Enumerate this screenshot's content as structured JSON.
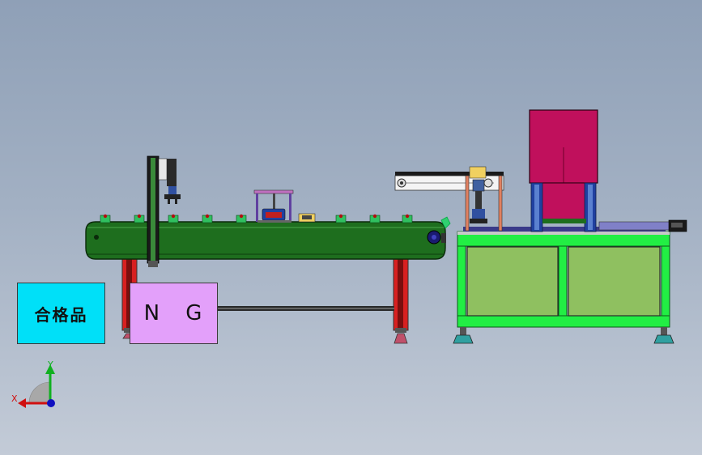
{
  "bins": {
    "ok_label": "合格品",
    "ng_label": "N G"
  },
  "axes": {
    "x_label": "X",
    "y_label": "Y"
  },
  "colors": {
    "conveyor": "#1e6e1e",
    "frame": "#22ee44",
    "panel": "#8fc060",
    "cabinet": "#c0105c",
    "ok_bin": "#00e0f8",
    "ng_bin": "#e3a0fa",
    "leg_red": "#e01010"
  }
}
